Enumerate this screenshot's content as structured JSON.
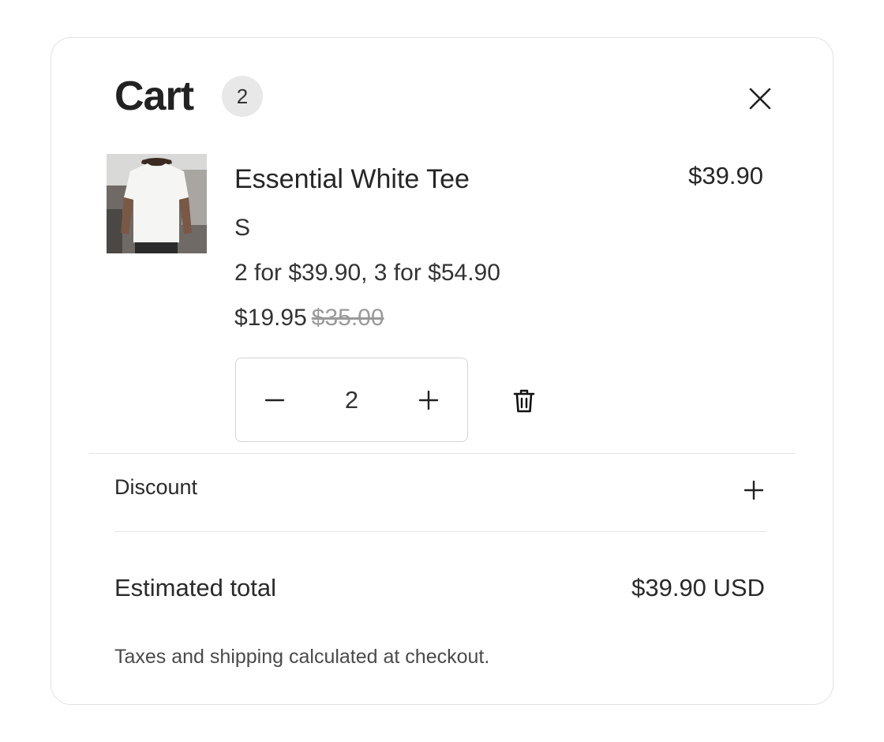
{
  "cart": {
    "title": "Cart",
    "count": "2",
    "close_icon": "close-icon"
  },
  "item": {
    "image_icon": "product-image-white-tee",
    "name": "Essential White Tee",
    "line_price": "$39.90",
    "variant": "S",
    "promotion": "2 for $39.90, 3 for $54.90",
    "unit_price": "$19.95",
    "compare_at_price": "$35.00",
    "quantity": "2",
    "decrement_icon": "minus-icon",
    "increment_icon": "plus-icon",
    "remove_icon": "trash-icon"
  },
  "discount": {
    "label": "Discount",
    "toggle_icon": "plus-icon"
  },
  "summary": {
    "total_label": "Estimated total",
    "total_value": "$39.90 USD",
    "tax_note": "Taxes and shipping calculated at checkout."
  }
}
